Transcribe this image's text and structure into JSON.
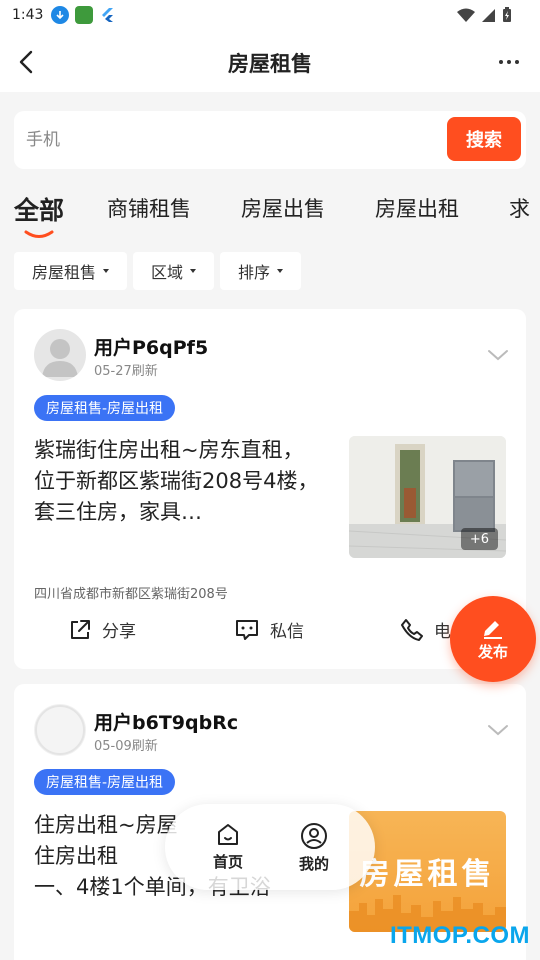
{
  "status_bar": {
    "time": "1:43"
  },
  "header": {
    "title": "房屋租售"
  },
  "search": {
    "placeholder": "手机",
    "button_label": "搜索"
  },
  "tabs": [
    {
      "label": "全部",
      "active": true
    },
    {
      "label": "商铺租售",
      "active": false
    },
    {
      "label": "房屋出售",
      "active": false
    },
    {
      "label": "房屋出租",
      "active": false
    },
    {
      "label": "求",
      "active": false
    }
  ],
  "filters": [
    {
      "label": "房屋租售"
    },
    {
      "label": "区域"
    },
    {
      "label": "排序"
    }
  ],
  "posts": [
    {
      "user": "用户P6qPf5",
      "refresh_time": "05-27刷新",
      "tag": "房屋租售-房屋出租",
      "description": "紫瑞街住房出租~房东直租，位于新都区紫瑞街208号4楼，套三住房，家具…",
      "image_count": "+6",
      "address": "四川省成都市新都区紫瑞街208号",
      "actions": {
        "share": "分享",
        "message": "私信",
        "phone": "电"
      }
    },
    {
      "user": "用户b6T9qbRc",
      "refresh_time": "05-09刷新",
      "tag": "房屋租售-房屋出租",
      "description_lines": [
        "住房出租~房屋",
        "住房出租",
        "一、4楼1个单间，有卫浴"
      ],
      "image_text": "房屋租售"
    }
  ],
  "fab": {
    "label": "发布"
  },
  "bottom_nav": [
    {
      "label": "首页",
      "icon": "home-icon"
    },
    {
      "label": "我的",
      "icon": "user-icon"
    }
  ],
  "watermark": "ITMOP.COM",
  "colors": {
    "accent": "#ff4e1f",
    "tag_blue": "#3b73f5",
    "background": "#f5f5f5"
  }
}
